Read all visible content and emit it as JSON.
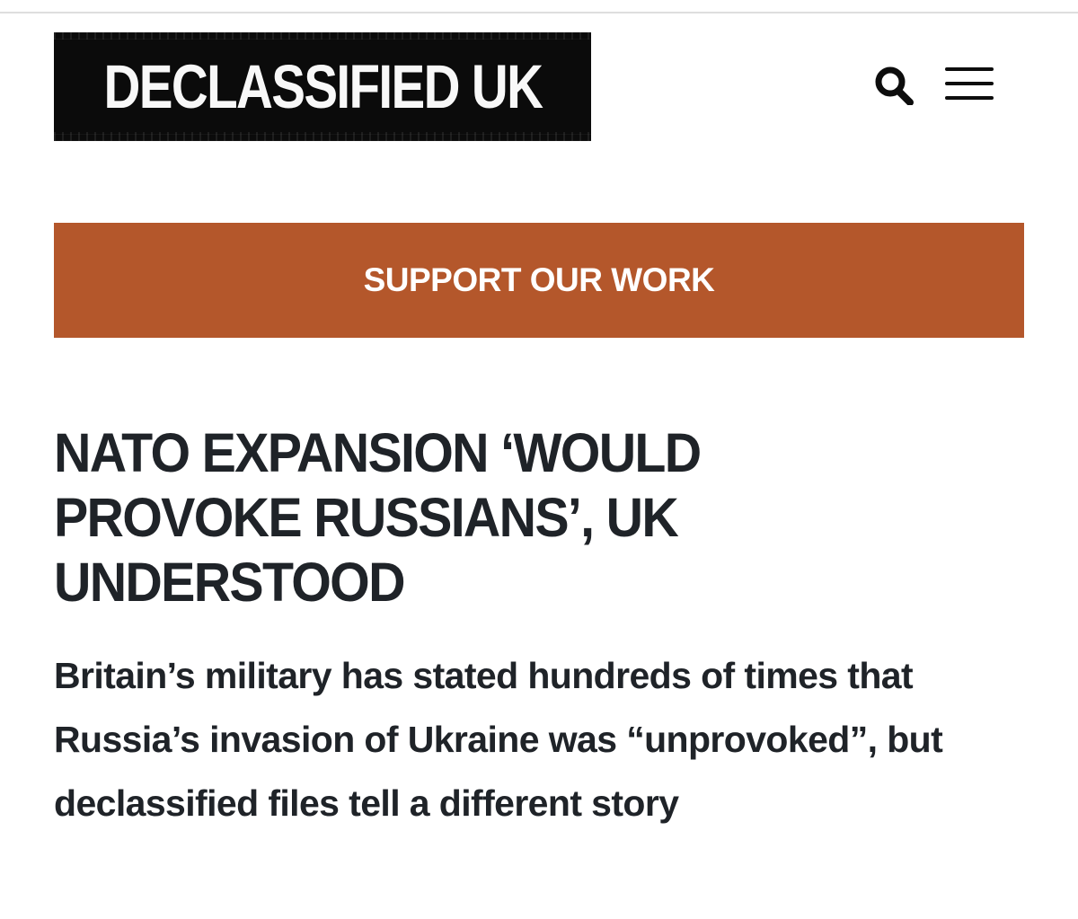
{
  "site": {
    "logo_text": "DECLASSIFIED UK"
  },
  "header": {
    "icons": [
      "search-icon",
      "menu-icon"
    ]
  },
  "cta": {
    "label": "SUPPORT OUR WORK",
    "background": "#b4572b"
  },
  "article": {
    "headline": "NATO EXPANSION ‘WOULD PROVOKE RUSSIANS’, UK UNDERSTOOD",
    "standfirst": "Britain’s military has stated hundreds of times that Russia’s invasion of Ukraine was “unprovoked”, but declassified files tell a different story"
  },
  "colors": {
    "text": "#1f2328",
    "logo_background": "#0b0b0b",
    "logo_text": "#f8f8f8",
    "divider": "#dedede"
  }
}
